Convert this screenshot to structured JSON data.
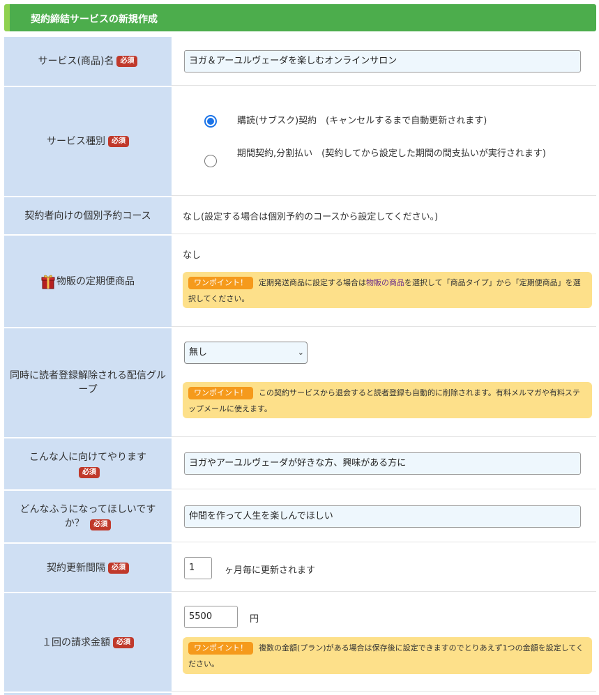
{
  "title": "契約締結サービスの新規作成",
  "required_label": "必須",
  "tip_label": "ワンポイント！",
  "service_name": {
    "label": "サービス(商品)名",
    "value": "ヨガ＆アーユルヴェーダを楽しむオンラインサロン"
  },
  "service_type": {
    "label": "サービス種別",
    "options": [
      {
        "label": "購読(サブスク)契約　(キャンセルするまで自動更新されます)",
        "checked": true
      },
      {
        "label": "期間契約,分割払い　(契約してから設定した期間の間支払いが実行されます)",
        "checked": false
      }
    ]
  },
  "course": {
    "label": "契約者向けの個別予約コース",
    "value": "なし(設定する場合は個別予約のコースから設定してください。)"
  },
  "product": {
    "label": "物販の定期便商品",
    "icon": "gift-icon",
    "value": "なし",
    "tip_pre": "定期発送商品に設定する場合は",
    "tip_link": "物販の商品",
    "tip_post": "を選択して「商品タイプ」から「定期便商品」を選択してください。"
  },
  "group": {
    "label": "同時に読者登録解除される配信グループ",
    "selected": "無し",
    "tip": "この契約サービスから退会すると読者登録も自動的に削除されます。有料メルマガや有料ステップメールに使えます。"
  },
  "target": {
    "label": "こんな人に向けてやります",
    "value": "ヨガやアーユルヴェーダが好きな方、興味がある方に"
  },
  "goal": {
    "label": "どんなふうになってほしいですか？",
    "value": "仲間を作って人生を楽しんでほしい"
  },
  "interval": {
    "label": "契約更新間隔",
    "value": "1",
    "unit": "ヶ月毎に更新されます"
  },
  "amount": {
    "label": "１回の請求金額",
    "value": "5500",
    "unit": "円",
    "tip": "複数の金額(プラン)がある場合は保存後に設定できますのでとりあえず1つの金額を設定してください。"
  },
  "colors": {
    "header": "#4cad4c",
    "label_bg": "#cfdff3",
    "required": "#c0392b",
    "tip_bg": "#fde08a",
    "tip_badge": "#f59a1c"
  }
}
